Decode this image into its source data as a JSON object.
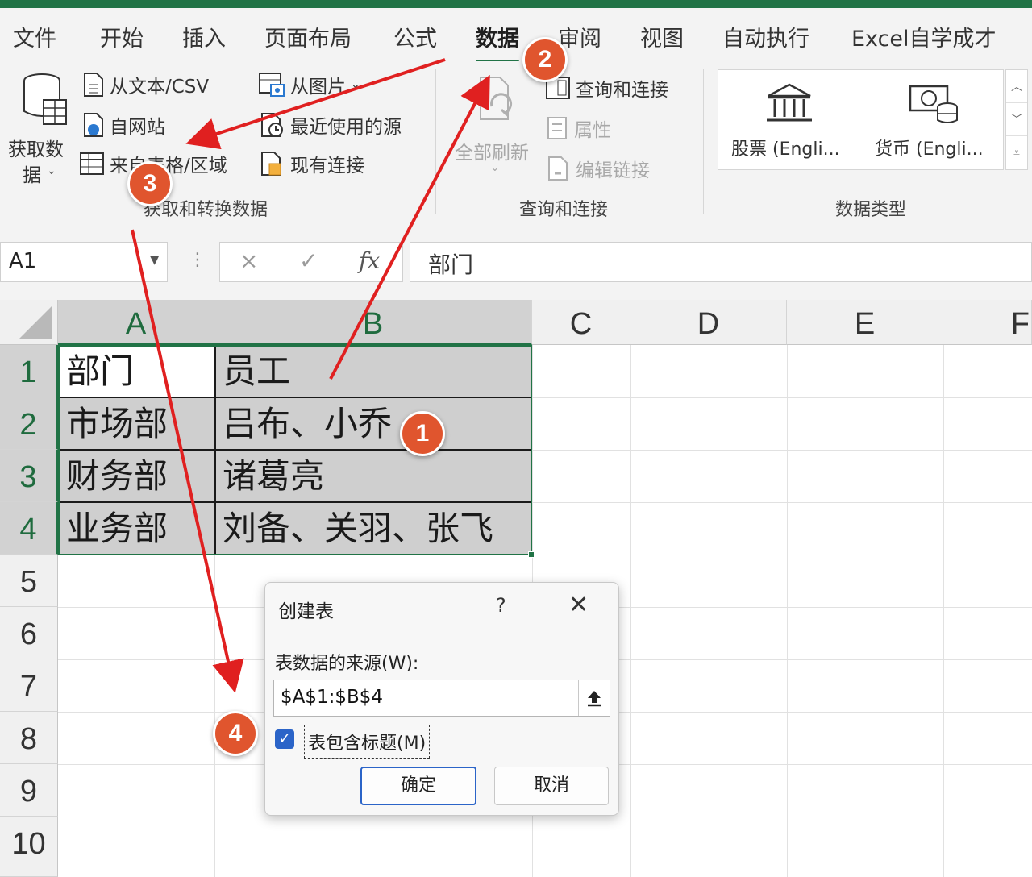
{
  "ribbon_tabs": [
    {
      "label": "文件"
    },
    {
      "label": "开始"
    },
    {
      "label": "插入"
    },
    {
      "label": "页面布局"
    },
    {
      "label": "公式"
    },
    {
      "label": "数据",
      "active": true
    },
    {
      "label": "审阅"
    },
    {
      "label": "视图"
    },
    {
      "label": "自动执行"
    },
    {
      "label": "Excel自学成才"
    }
  ],
  "ribbon": {
    "get_data": {
      "line1": "获取数",
      "line2": "据"
    },
    "from_text_csv": "从文本/CSV",
    "from_web": "自网站",
    "from_table_range": "来自表格/区域",
    "from_picture": "从图片",
    "recent_sources": "最近使用的源",
    "existing_connections": "现有连接",
    "group_get_transform": "获取和转换数据",
    "refresh_all": "全部刷新",
    "queries_connections": "查询和连接",
    "properties": "属性",
    "edit_links": "编辑链接",
    "group_queries": "查询和连接",
    "stocks": "股票 (Engli...",
    "currencies": "货币 (Engli...",
    "group_data_types": "数据类型"
  },
  "formula_bar": {
    "name_box": "A1",
    "fx": "fx",
    "cancel": "×",
    "enter": "✓",
    "content": "部门"
  },
  "columns": [
    "A",
    "B",
    "C",
    "D",
    "E",
    "F"
  ],
  "rows": [
    "1",
    "2",
    "3",
    "4",
    "5",
    "6",
    "7",
    "8",
    "9",
    "10"
  ],
  "cells": {
    "A1": "部门",
    "B1": "员工",
    "A2": "市场部",
    "B2": "吕布、小乔",
    "A3": "财务部",
    "B3": "诸葛亮",
    "A4": "业务部",
    "B4": "刘备、关羽、张飞"
  },
  "dialog": {
    "title": "创建表",
    "help": "?",
    "source_label": "表数据的来源(W):",
    "source_value": "$A$1:$B$4",
    "has_headers_label": "表包含标题(M)",
    "has_headers_checked": true,
    "ok": "确定",
    "cancel": "取消"
  },
  "annotations": [
    {
      "label": "1"
    },
    {
      "label": "2"
    },
    {
      "label": "3"
    },
    {
      "label": "4"
    }
  ],
  "colors": {
    "accent": "#217346",
    "annotation": "#e0552e",
    "arrow": "#e02020",
    "checkbox": "#2b64c8"
  }
}
